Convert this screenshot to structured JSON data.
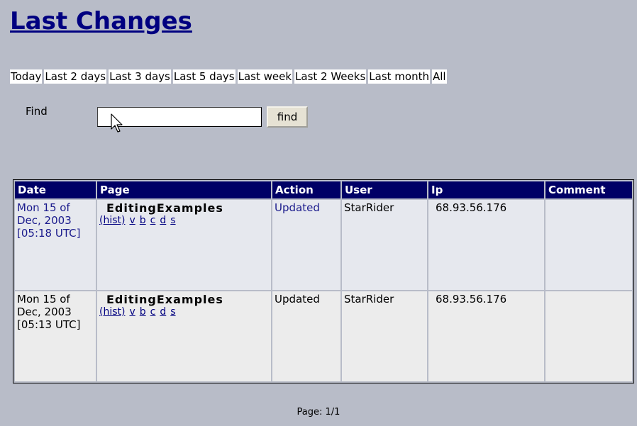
{
  "page": {
    "title": "Last Changes",
    "filters": [
      "Today",
      "Last 2 days",
      "Last 3 days",
      "Last 5 days",
      "Last week",
      "Last 2 Weeks",
      "Last month",
      "All"
    ],
    "find_label": "Find",
    "find_value": "",
    "find_button": "find",
    "pagination": "Page: 1/1"
  },
  "table": {
    "headers": {
      "date": "Date",
      "page": "Page",
      "action": "Action",
      "user": "User",
      "ip": "Ip",
      "comment": "Comment"
    },
    "rows": [
      {
        "date": "Mon 15 of Dec, 2003 [05:18 UTC]",
        "page": "EditingExamples",
        "links": {
          "hist": "(hist)",
          "v": "v",
          "b": "b",
          "c": "c",
          "d": "d",
          "s": "s"
        },
        "action": "Updated",
        "user": "StarRider",
        "ip": "68.93.56.176",
        "comment": ""
      },
      {
        "date": "Mon 15 of Dec, 2003 [05:13 UTC]",
        "page": "EditingExamples",
        "links": {
          "hist": "(hist)",
          "v": "v",
          "b": "b",
          "c": "c",
          "d": "d",
          "s": "s"
        },
        "action": "Updated",
        "user": "StarRider",
        "ip": "68.93.56.176",
        "comment": ""
      }
    ]
  },
  "icons": {
    "cursor": "mouse-pointer-icon"
  }
}
